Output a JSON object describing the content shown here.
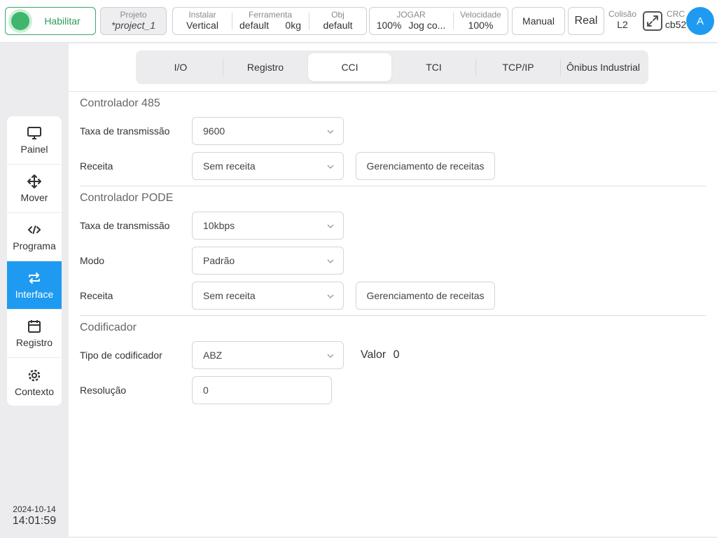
{
  "header": {
    "enable_label": "Habilitar",
    "project": {
      "caption": "Projeto",
      "value": "*project_1"
    },
    "install": {
      "caption": "Instalar",
      "value": "Vertical"
    },
    "tool": {
      "caption": "Ferramenta",
      "name": "default",
      "weight": "0kg"
    },
    "obj": {
      "caption": "Obj",
      "value": "default"
    },
    "jog": {
      "caption": "JOGAR",
      "percent": "100%",
      "mode": "Jog co..."
    },
    "speed": {
      "caption": "Velocidade",
      "value": "100%"
    },
    "manual_label": "Manual",
    "real_label": "Real",
    "collision": {
      "caption": "Colisão",
      "value": "L2"
    },
    "crc": {
      "caption": "CRC",
      "value": "cb52"
    },
    "avatar_letter": "A"
  },
  "sidebar": {
    "items": [
      {
        "label": "Painel",
        "icon": "monitor-icon"
      },
      {
        "label": "Mover",
        "icon": "move-icon"
      },
      {
        "label": "Programa",
        "icon": "code-icon"
      },
      {
        "label": "Interface",
        "icon": "interface-icon",
        "active": true
      },
      {
        "label": "Registro",
        "icon": "calendar-icon"
      },
      {
        "label": "Contexto",
        "icon": "gear-icon"
      }
    ],
    "date": "2024-10-14",
    "time": "14:01:59"
  },
  "tabs": [
    "I/O",
    "Registro",
    "CCI",
    "TCI",
    "TCP/IP",
    "Ônibus Industrial"
  ],
  "active_tab": "CCI",
  "main": {
    "sections": [
      {
        "title": "Controlador 485",
        "baud_label": "Taxa de transmissão",
        "baud_value": "9600",
        "recipe_label": "Receita",
        "recipe_value": "Sem receita",
        "recipe_mgmt": "Gerenciamento de receitas"
      },
      {
        "title": "Controlador PODE",
        "baud_label": "Taxa de transmissão",
        "baud_value": "10kbps",
        "mode_label": "Modo",
        "mode_value": "Padrão",
        "recipe_label": "Receita",
        "recipe_value": "Sem receita",
        "recipe_mgmt": "Gerenciamento de receitas"
      },
      {
        "title": "Codificador",
        "type_label": "Tipo de codificador",
        "type_value": "ABZ",
        "value_label": "Valor",
        "value": "0",
        "resolution_label": "Resolução",
        "resolution_value": "0"
      }
    ]
  },
  "colors": {
    "accent": "#1e9bf0",
    "enable_green": "#3fb66c"
  }
}
